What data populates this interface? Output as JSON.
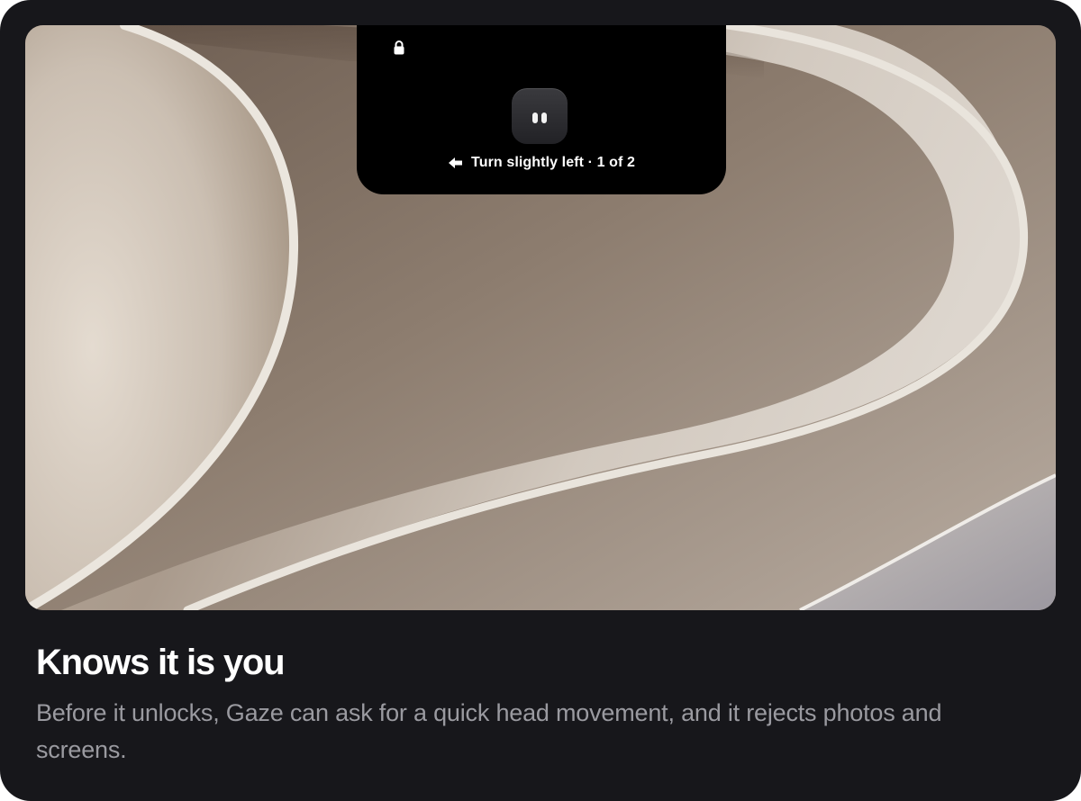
{
  "card": {
    "title": "Knows it is you",
    "description": "Before it unlocks, Gaze can ask for a quick head movement, and it rejects photos and screens."
  },
  "notch": {
    "hint": "Turn slightly left · 1 of 2",
    "icons": [
      "lock-icon",
      "face-icon",
      "arrow-left-icon"
    ]
  },
  "colors": {
    "card_background": "#17171b",
    "notch_background": "#000000",
    "title_text": "#ffffff",
    "description_text": "#9a9aa0"
  }
}
